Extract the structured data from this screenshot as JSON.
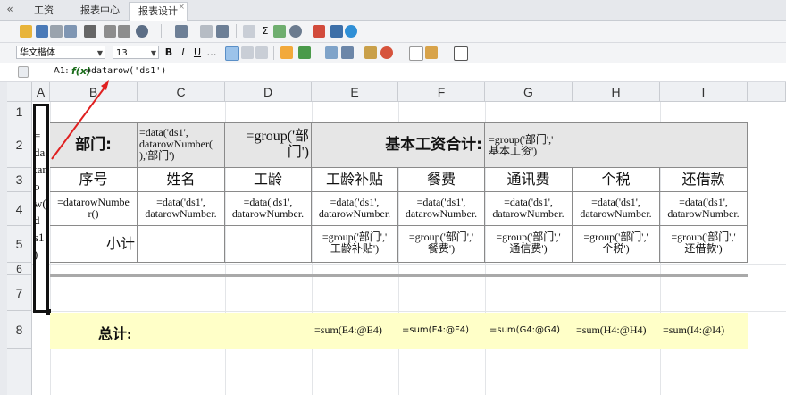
{
  "tabs": {
    "collapse_icon": "«",
    "t1": "工资",
    "t2": "报表中心",
    "t3": "报表设计",
    "close": "×"
  },
  "toolbar": {
    "font": "华文楷体",
    "size": "13",
    "bold": "B",
    "italic": "I",
    "underline": "U",
    "more": "…",
    "sum_icon": "Σ"
  },
  "formula": {
    "cell": "A1:",
    "fx": "f(x)",
    "text": "=datarow('ds1')"
  },
  "columns": [
    "A",
    "B",
    "C",
    "D",
    "E",
    "F",
    "G",
    "H",
    "I"
  ],
  "rows": [
    "1",
    "2",
    "3",
    "4",
    "5",
    "6",
    "7",
    "8"
  ],
  "cells": {
    "a_vertical": "=\nda\ntar\no\nw(\nd\ns1\n)",
    "dept_label": "部门:",
    "dept_data": "=data('ds1',\ndatarowNumber(\n),'部门')",
    "dept_group": "=group('部\n门')",
    "base_label": "基本工资合计:",
    "base_group": "=group('部门','\n基本工资')",
    "headers": [
      "序号",
      "姓名",
      "工龄",
      "工龄补贴",
      "餐费",
      "通讯费",
      "个税",
      "还借款"
    ],
    "row4": [
      "=datarowNumbe\nr()",
      "=data('ds1',\ndatarowNumber.",
      "=data('ds1',\ndatarowNumber.",
      "=data('ds1',\ndatarowNumber.",
      "=data('ds1',\ndatarowNumber.",
      "=data('ds1',\ndatarowNumber.",
      "=data('ds1',\ndatarowNumber.",
      "=data('ds1',\ndatarowNumber."
    ],
    "subtotal": "小计",
    "row5": [
      "=group('部门','\n工龄补贴')",
      "=group('部门','\n餐费')",
      "=group('部门','\n通信费')",
      "=group('部门','\n个税')",
      "=group('部门','\n还借款')"
    ],
    "total_label": "总计:",
    "totals": [
      "=sum(E4:@E4)",
      "=sum(F4:@F4)",
      "=sum(G4:@G4)",
      "=sum(H4:@H4)",
      "=sum(I4:@I4)"
    ]
  },
  "colors": {
    "header_bg": "#e6e6e6",
    "total_bg": "#ffffc8",
    "arrow": "#e02020"
  }
}
